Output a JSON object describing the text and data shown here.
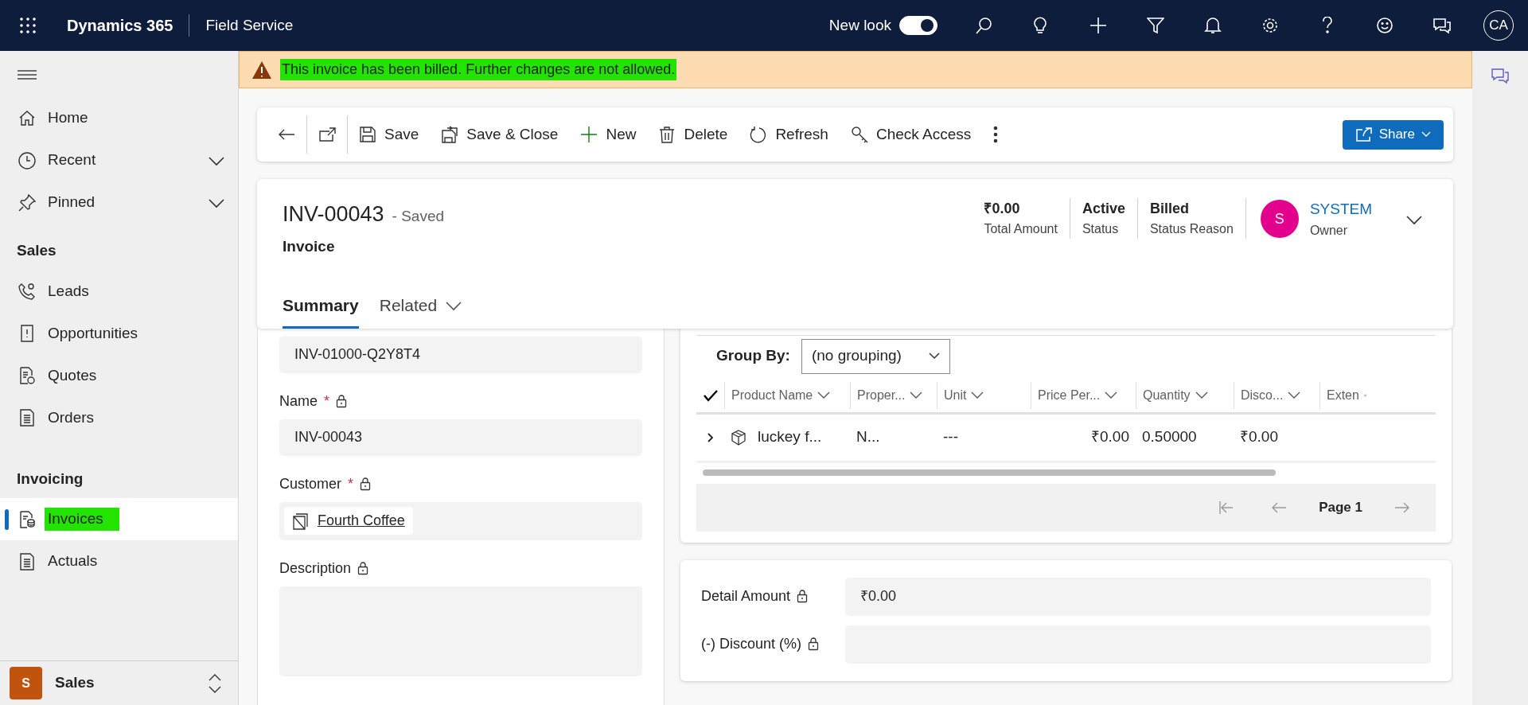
{
  "top_bar": {
    "app_name": "Dynamics 365",
    "area": "Field Service",
    "new_look": {
      "label": "New look",
      "on": true
    },
    "avatar": "CA"
  },
  "banner": {
    "message": "This invoice has been billed. Further changes are not allowed.",
    "highlighted": true
  },
  "sidebar": {
    "nav": [
      {
        "label": "Home",
        "selected": false,
        "expandable": false,
        "highlighted": false
      },
      {
        "label": "Recent",
        "selected": false,
        "expandable": true,
        "highlighted": false
      },
      {
        "label": "Pinned",
        "selected": false,
        "expandable": true,
        "highlighted": false
      }
    ],
    "groups": [
      {
        "title": "Sales",
        "items": [
          {
            "label": "Leads",
            "selected": false,
            "highlighted": false
          },
          {
            "label": "Opportunities",
            "selected": false,
            "highlighted": false
          },
          {
            "label": "Quotes",
            "selected": false,
            "highlighted": false
          },
          {
            "label": "Orders",
            "selected": false,
            "highlighted": false
          }
        ]
      },
      {
        "title": "Invoicing",
        "items": [
          {
            "label": "Invoices",
            "selected": true,
            "highlighted": true
          },
          {
            "label": "Actuals",
            "selected": false,
            "highlighted": false
          }
        ]
      }
    ],
    "area_switcher": {
      "initial": "S",
      "label": "Sales"
    }
  },
  "command_bar": {
    "buttons": [
      "Save",
      "Save & Close",
      "New",
      "Delete",
      "Refresh",
      "Check Access"
    ],
    "share": "Share"
  },
  "header": {
    "title": "INV-00043",
    "save_state": "- Saved",
    "entity": "Invoice",
    "fields": [
      {
        "value": "₹0.00",
        "label": "Total Amount"
      },
      {
        "value": "Active",
        "label": "Status"
      },
      {
        "value": "Billed",
        "label": "Status Reason"
      }
    ],
    "owner": {
      "initial": "S",
      "name": "SYSTEM",
      "label": "Owner"
    },
    "tabs": [
      {
        "label": "Summary",
        "selected": true,
        "dropdown": false
      },
      {
        "label": "Related",
        "selected": false,
        "dropdown": true
      }
    ]
  },
  "form": {
    "fields": [
      {
        "kind": "text",
        "value": "INV-01000-Q2Y8T4"
      },
      {
        "kind": "text",
        "label": "Name",
        "required_marker": "*",
        "locked": true,
        "value": "INV-00043"
      },
      {
        "kind": "lookup",
        "label": "Customer",
        "required_marker": "*",
        "locked": true,
        "value": "Fourth Coffee"
      },
      {
        "kind": "textarea",
        "label": "Description",
        "locked": true
      }
    ]
  },
  "products_grid": {
    "group_by": {
      "label": "Group By:",
      "value": "(no grouping)"
    },
    "columns": [
      "Product Name",
      "Proper...",
      "Unit",
      "Price Per...",
      "Quantity",
      "Disco...",
      "Exten"
    ],
    "rows": [
      {
        "expanded": false,
        "cells": [
          "luckey f...",
          "N...",
          "---",
          "₹0.00",
          "0.50000",
          "₹0.00"
        ]
      }
    ],
    "pager": "Page 1"
  },
  "totals": {
    "fields": [
      {
        "label": "Detail Amount",
        "locked": true,
        "value": "₹0.00"
      },
      {
        "label": "(-) Discount (%)",
        "locked": true
      }
    ]
  }
}
